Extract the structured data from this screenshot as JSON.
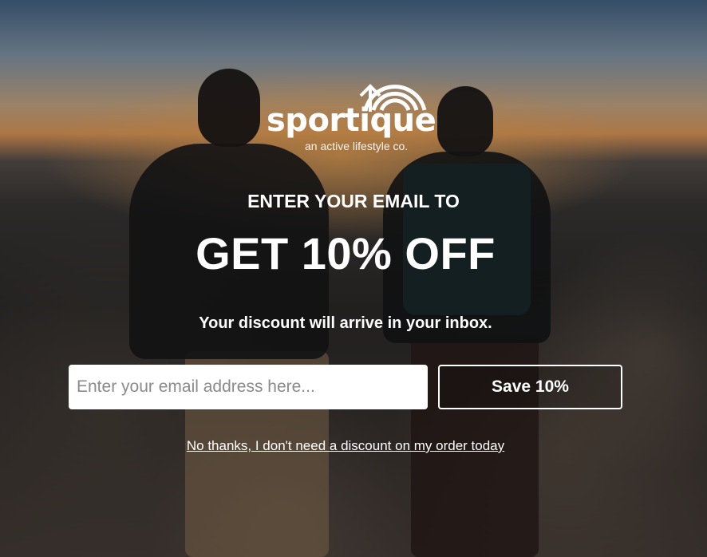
{
  "brand": {
    "name": "sportique",
    "tagline": "an active lifestyle co."
  },
  "popup": {
    "headline_line1": "ENTER YOUR EMAIL TO",
    "headline_line2": "GET 10% OFF",
    "subtext": "Your discount will arrive in your inbox.",
    "email_input": {
      "value": "",
      "placeholder": "Enter your email address here..."
    },
    "submit_label": "Save 10%",
    "decline_label": "No thanks, I don't need a discount on my order today"
  },
  "colors": {
    "text": "#ffffff",
    "input_bg": "#ffffff",
    "placeholder": "#8a8a8a"
  }
}
